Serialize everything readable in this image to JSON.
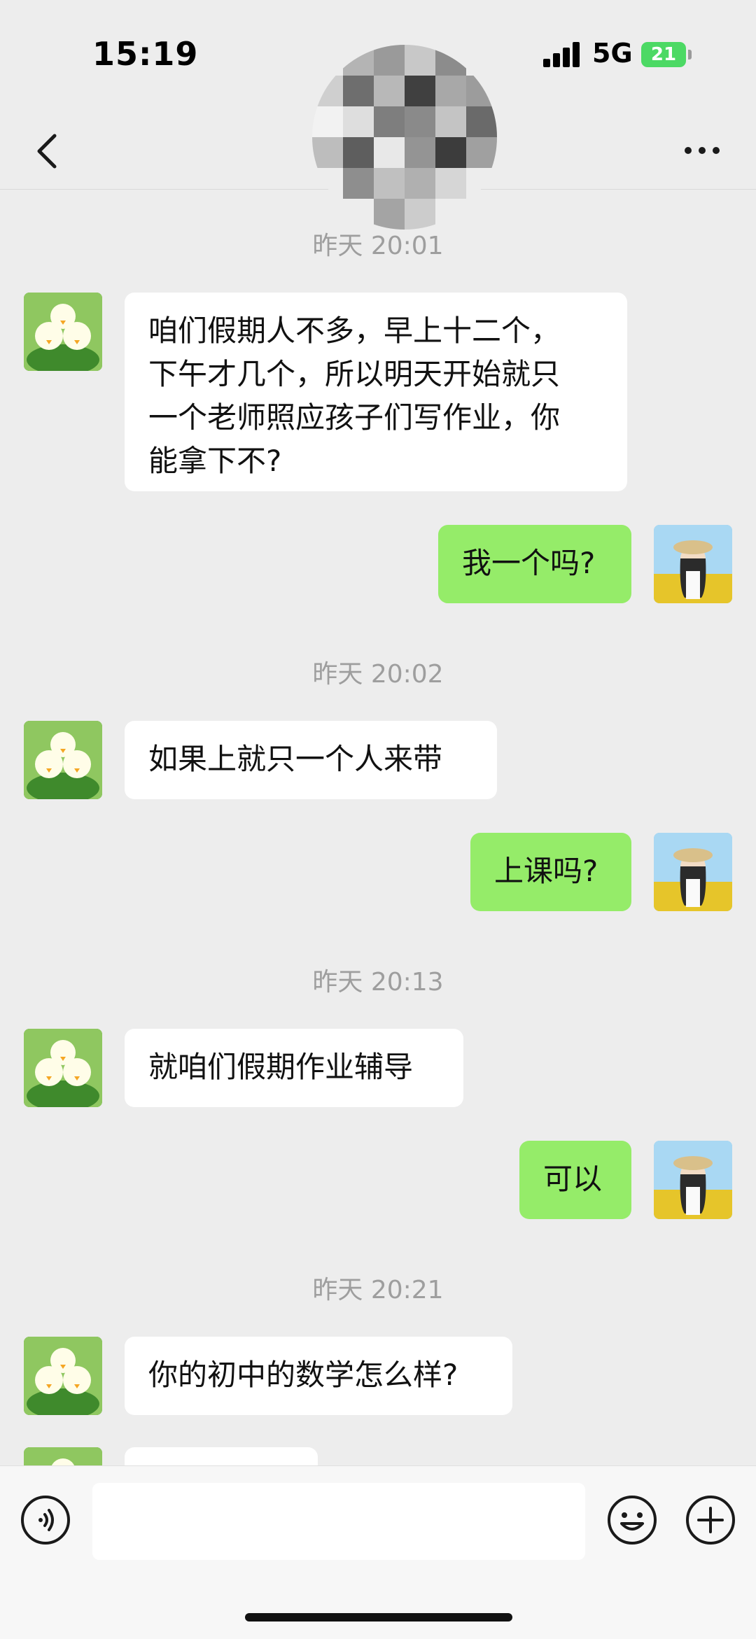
{
  "status_bar": {
    "time": "15:19",
    "network": "5G",
    "battery": "21"
  },
  "nav": {
    "back_icon": "chevron-left-icon",
    "more_icon": "ellipsis-icon"
  },
  "messages": [
    {
      "type": "time",
      "text": "昨天 20:01"
    },
    {
      "type": "in",
      "text": "咱们假期人不多，早上十二个，\n下午才几个，所以明天开始就只\n一个老师照应孩子们写作业，你\n能拿下不?"
    },
    {
      "type": "out",
      "text": "我一个吗?"
    },
    {
      "type": "time",
      "text": "昨天 20:02"
    },
    {
      "type": "in",
      "text": "如果上就只一个人来带"
    },
    {
      "type": "out",
      "text": "上课吗?"
    },
    {
      "type": "time",
      "text": "昨天 20:13"
    },
    {
      "type": "in",
      "text": "就咱们假期作业辅导"
    },
    {
      "type": "out",
      "text": "可以"
    },
    {
      "type": "time",
      "text": "昨天 20:21"
    },
    {
      "type": "in",
      "text": "你的初中的数学怎么样?"
    },
    {
      "type": "in",
      "text": ""
    }
  ],
  "input_bar": {
    "placeholder": "",
    "voice_icon": "voice-icon",
    "emoji_icon": "emoji-icon",
    "plus_icon": "plus-icon"
  },
  "colors": {
    "background": "#ededed",
    "incoming_bubble": "#ffffff",
    "outgoing_bubble": "#95ec69",
    "timestamp": "#9e9e9e"
  }
}
